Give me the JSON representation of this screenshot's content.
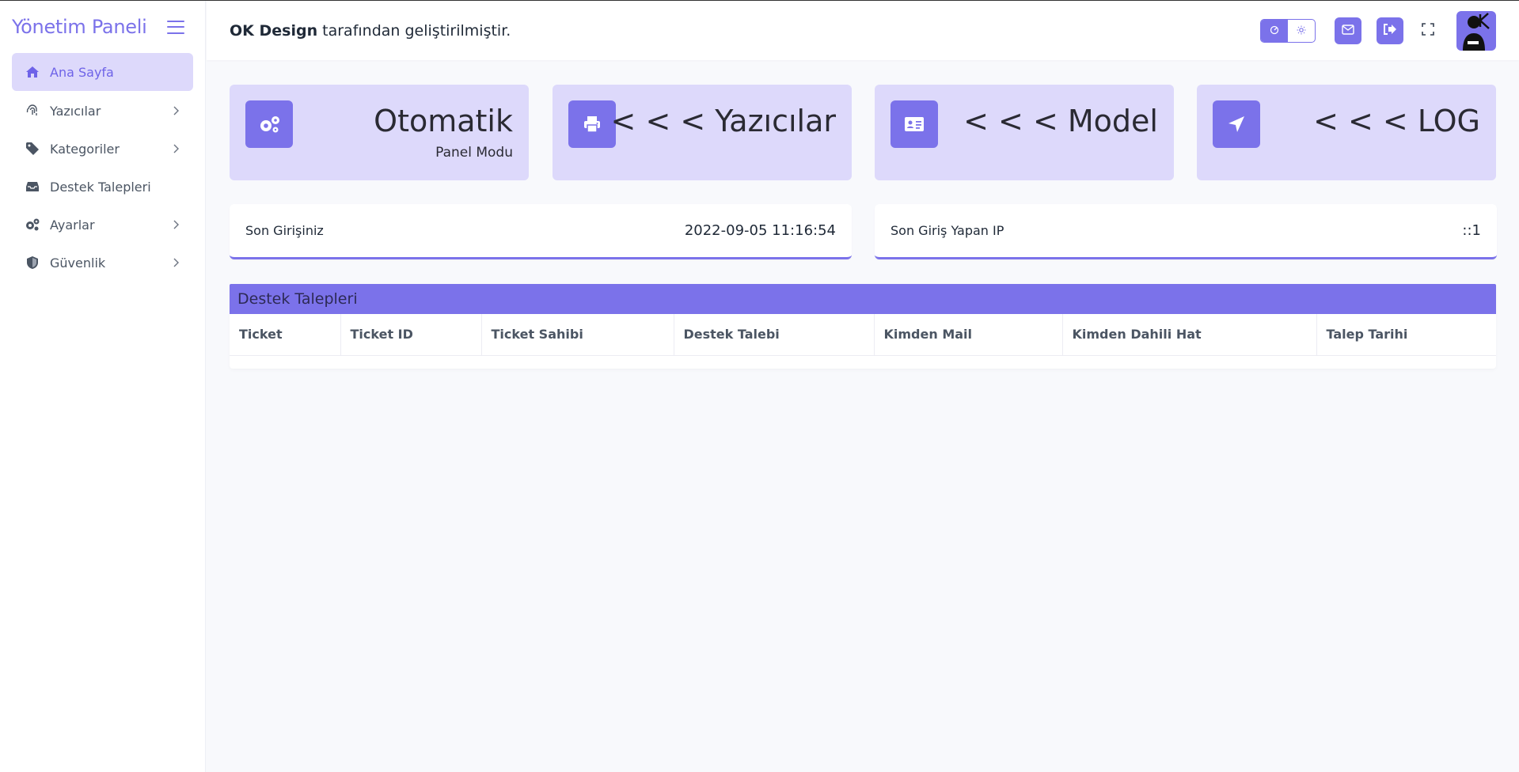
{
  "sidebar": {
    "title": "Yönetim Paneli",
    "items": [
      {
        "label": "Ana Sayfa",
        "icon": "home-icon",
        "active": true,
        "has_children": false
      },
      {
        "label": "Yazıcılar",
        "icon": "fingerprint-icon",
        "active": false,
        "has_children": true
      },
      {
        "label": "Kategoriler",
        "icon": "tag-icon",
        "active": false,
        "has_children": true
      },
      {
        "label": "Destek Talepleri",
        "icon": "inbox-icon",
        "active": false,
        "has_children": false
      },
      {
        "label": "Ayarlar",
        "icon": "gears-icon",
        "active": false,
        "has_children": true
      },
      {
        "label": "Güvenlik",
        "icon": "shield-icon",
        "active": false,
        "has_children": true
      }
    ]
  },
  "header": {
    "credit_brand": "OK Design",
    "credit_rest": " tarafından geliştirilmiştir.",
    "theme_icons": [
      "dark-mode-icon",
      "light-mode-icon"
    ],
    "actions": [
      "mail-icon",
      "logout-icon",
      "fullscreen-icon"
    ],
    "avatar_text": "OK"
  },
  "cards": [
    {
      "title": "Otomatik",
      "subtitle": "Panel Modu",
      "icon": "gears-icon"
    },
    {
      "title": "< < < Yazıcılar",
      "subtitle": "",
      "icon": "printer-icon"
    },
    {
      "title": "< < < Model",
      "subtitle": "",
      "icon": "id-card-icon"
    },
    {
      "title": "< < < LOG",
      "subtitle": "",
      "icon": "location-arrow-icon"
    }
  ],
  "last_login": {
    "label": "Son Girişiniz",
    "value": "2022-09-05 11:16:54"
  },
  "last_ip": {
    "label": "Son Giriş Yapan IP",
    "value": "::1"
  },
  "tickets": {
    "title": "Destek Talepleri",
    "columns": [
      "Ticket",
      "Ticket ID",
      "Ticket Sahibi",
      "Destek Talebi",
      "Kimden Mail",
      "Kimden Dahili Hat",
      "Talep Tarihi"
    ],
    "rows": []
  },
  "colors": {
    "accent": "#7b72ea",
    "accent_light": "#ddd9fb",
    "background": "#f8f9fc"
  }
}
